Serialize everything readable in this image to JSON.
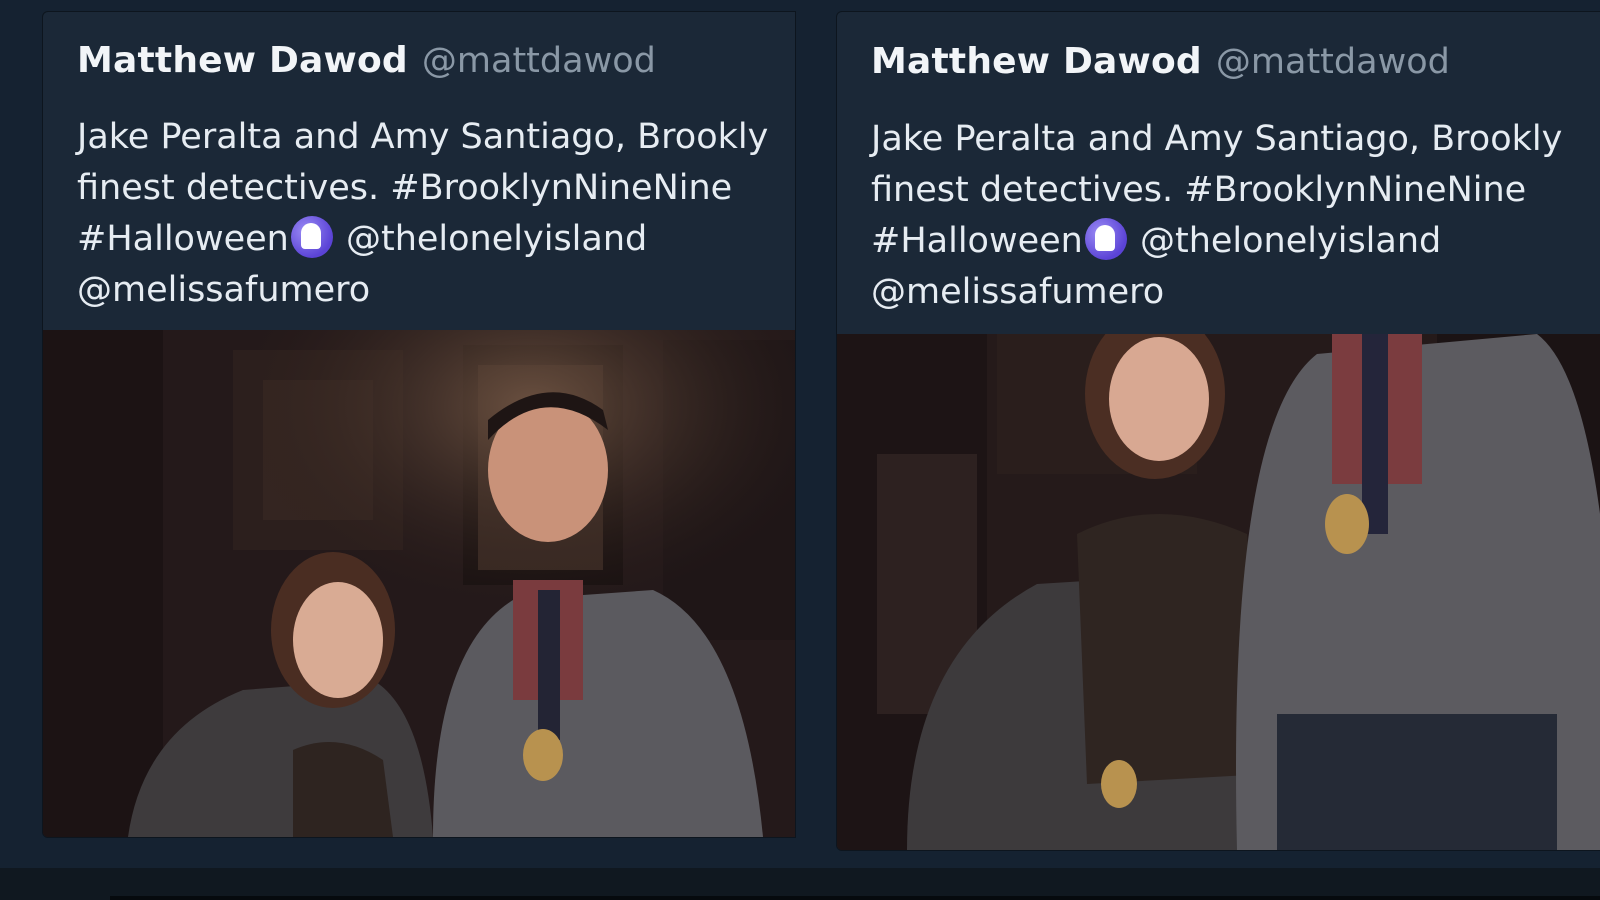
{
  "tweets": [
    {
      "author_name": "Matthew Dawod",
      "author_handle": "@mattdawod",
      "lines": [
        "Jake Peralta and Amy Santiago, Brookly",
        "finest detectives. #BrooklynNineNine",
        "#Halloween",
        "@thelonelyisland",
        "@melissafumero"
      ]
    },
    {
      "author_name": "Matthew Dawod",
      "author_handle": "@mattdawod",
      "lines": [
        "Jake Peralta and Amy Santiago, Brookly",
        "finest detectives. #BrooklynNineNine",
        "#Halloween",
        "@thelonelyisland",
        "@melissafumero"
      ]
    }
  ],
  "icons": {
    "ghost": "ghost-emoji-icon"
  },
  "colors": {
    "background": "#152231",
    "card": "#1b2837",
    "name": "#f2f5f8",
    "handle": "#8a98a6",
    "text": "#e6ecf2"
  }
}
